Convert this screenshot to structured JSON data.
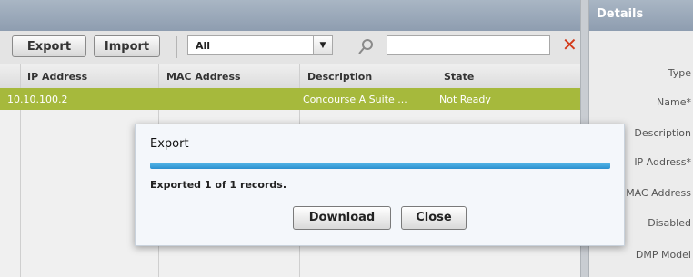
{
  "details": {
    "title": "Details",
    "fields": [
      "Type",
      "Name*",
      "Description",
      "IP Address*",
      "MAC Address",
      "Disabled",
      "DMP Model"
    ]
  },
  "toolbar": {
    "export_label": "Export",
    "import_label": "Import",
    "filter_value": "All"
  },
  "table": {
    "columns": [
      "IP Address",
      "MAC Address",
      "Description",
      "State"
    ],
    "rows": [
      {
        "ip": "10.10.100.2",
        "mac": "",
        "description": "Concourse A Suite ...",
        "state": "Not Ready"
      }
    ]
  },
  "dialog": {
    "title": "Export",
    "message": "Exported 1 of 1 records.",
    "progress": 1.0,
    "download_label": "Download",
    "close_label": "Close"
  }
}
